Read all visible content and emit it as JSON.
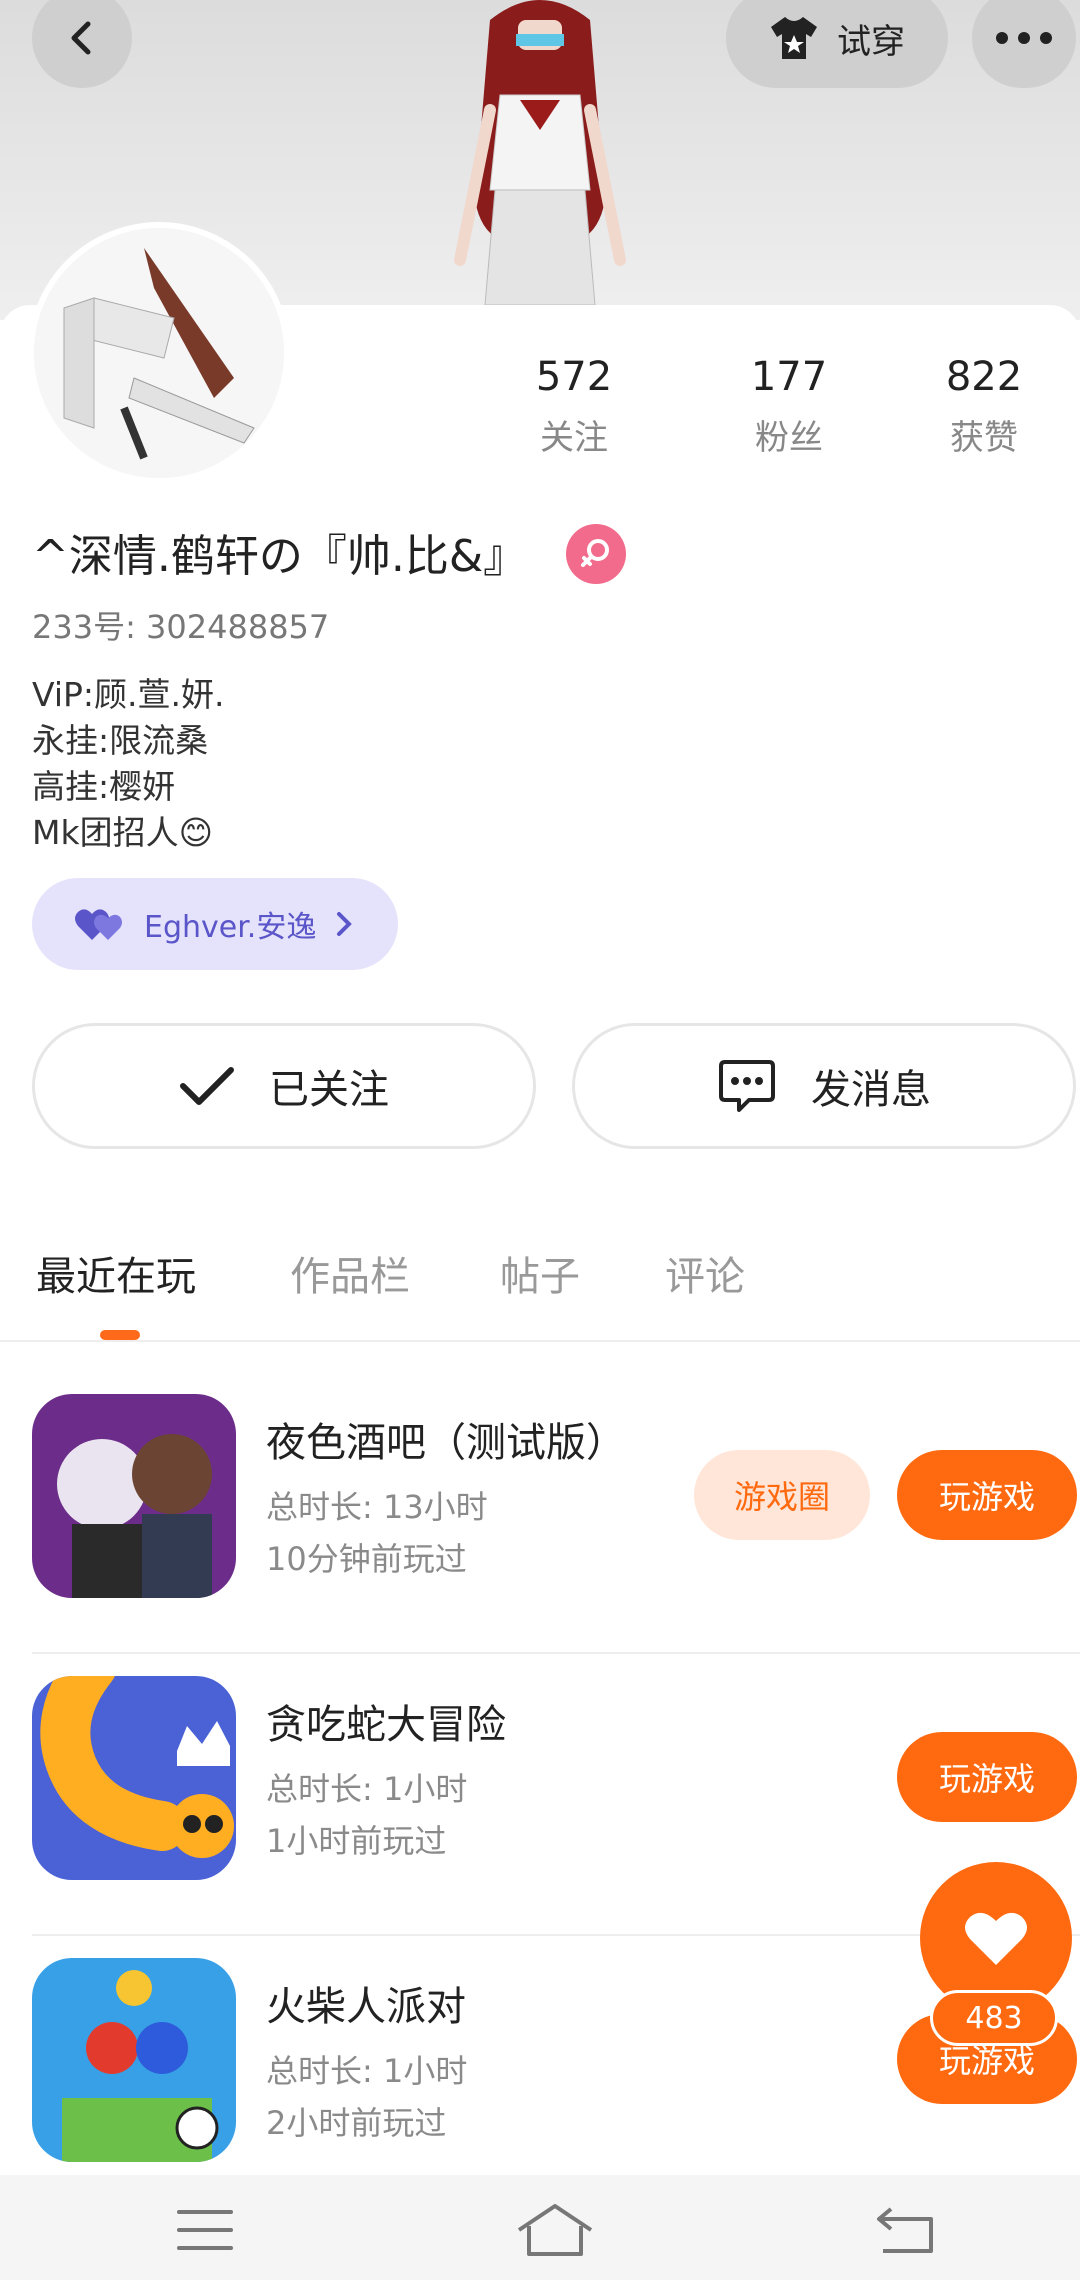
{
  "header": {
    "tryon_label": "试穿"
  },
  "profile": {
    "stats": [
      {
        "value": "572",
        "label": "关注"
      },
      {
        "value": "177",
        "label": "粉丝"
      },
      {
        "value": "822",
        "label": "获赞"
      }
    ],
    "nickname": "^深情.鹤轩の『帅.比&』",
    "uid": "233号: 302488857",
    "bio": [
      "ViP:顾.萱.妍.",
      "永挂:限流桑",
      "高挂:樱妍",
      "Mk团招人😊"
    ],
    "fan_badge": "Eghver.安逸",
    "follow_label": "已关注",
    "message_label": "发消息"
  },
  "tabs": [
    "最近在玩",
    "作品栏",
    "帖子",
    "评论"
  ],
  "games": [
    {
      "title": "夜色酒吧（测试版）",
      "duration": "总时长: 13小时",
      "last_played": "10分钟前玩过",
      "circle_label": "游戏圈",
      "play_label": "玩游戏"
    },
    {
      "title": "贪吃蛇大冒险",
      "duration": "总时长: 1小时",
      "last_played": "1小时前玩过",
      "play_label": "玩游戏"
    },
    {
      "title": "火柴人派对",
      "duration": "总时长: 1小时",
      "last_played": "2小时前玩过",
      "play_label": "玩游戏"
    }
  ],
  "fab": {
    "count": "483"
  },
  "colors": {
    "accent": "#ff6a10",
    "badge_pink": "#f26b8c",
    "fan_purple": "#5a55c9"
  }
}
